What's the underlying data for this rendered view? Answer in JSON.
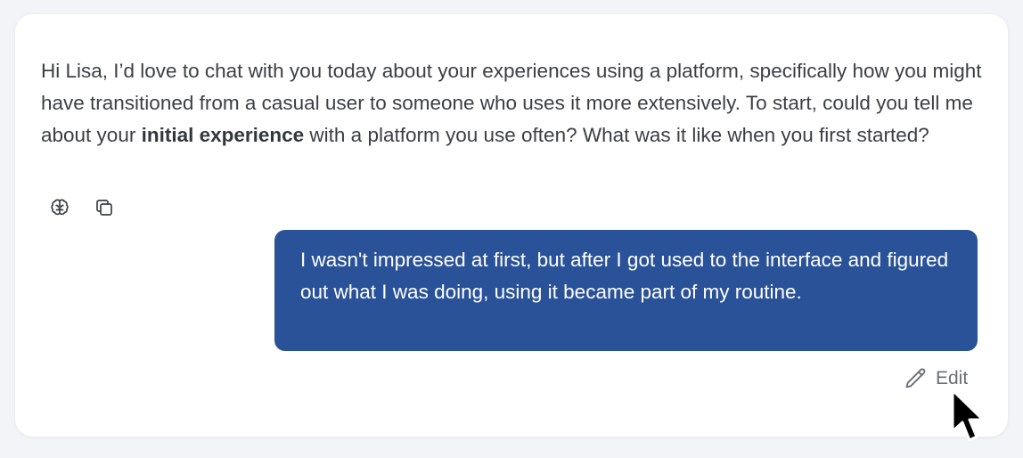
{
  "assistant_message": {
    "text_before": "Hi Lisa, I’d love to chat with you today about your experiences using a platform, specifically how you might have transitioned from a casual user to someone who uses it more extensively. To start, could you tell me about your ",
    "bold_text": "initial experience",
    "text_after": " with a platform you use often? What was it like when you first started?"
  },
  "message_actions": [
    {
      "icon": "brain-icon"
    },
    {
      "icon": "copy-icon"
    }
  ],
  "user_message": {
    "text": "I wasn't impressed at first, but after I got used to the interface and figured out what I was doing, using it became part of my routine."
  },
  "edit": {
    "label": "Edit",
    "icon": "pencil-icon"
  },
  "colors": {
    "user_bubble": "#2a5298",
    "assistant_text": "#3b3f45",
    "edit_text": "#6b6f76"
  }
}
